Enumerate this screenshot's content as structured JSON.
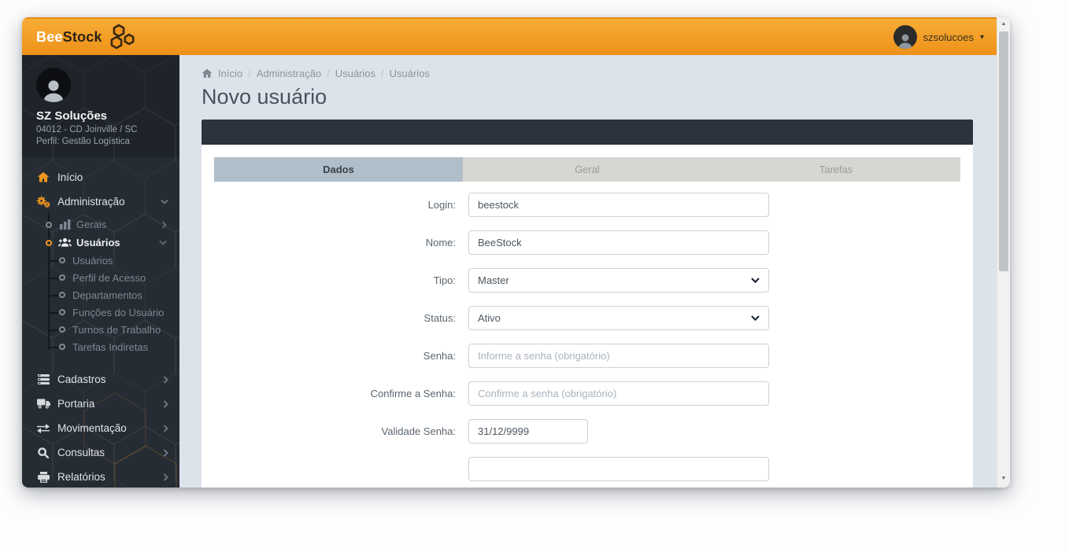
{
  "header": {
    "logo_bee": "Bee",
    "logo_stock": "Stock",
    "user_name": "szsolucoes"
  },
  "sidebar": {
    "profile": {
      "name": "SZ Soluções",
      "line1": "04012 - CD Joinville / SC",
      "line2": "Perfil: Gestão Logística"
    },
    "menu": {
      "inicio": "Início",
      "administracao": "Administração",
      "gerais": "Gerais",
      "usuarios_group": "Usuários",
      "sub": [
        "Usuários",
        "Perfil de Acesso",
        "Departamentos",
        "Funções do Usuário",
        "Turnos de Trabalho",
        "Tarefas Indiretas"
      ],
      "cadastros": "Cadastros",
      "portaria": "Portaria",
      "movimentacao": "Movimentação",
      "consultas": "Consultas",
      "relatorios": "Relatórios"
    }
  },
  "breadcrumb": {
    "items": [
      "Início",
      "Administração",
      "Usuários",
      "Usuários"
    ],
    "separator": "/"
  },
  "page": {
    "title": "Novo usuário"
  },
  "tabs": [
    {
      "label": "Dados"
    },
    {
      "label": "Geral"
    },
    {
      "label": "Tarefas"
    }
  ],
  "form": {
    "fields": [
      {
        "label": "Login:",
        "value": "beestock"
      },
      {
        "label": "Nome:",
        "value": "BeeStock"
      },
      {
        "label": "Tipo:",
        "value": "Master"
      },
      {
        "label": "Status:",
        "value": "Ativo"
      },
      {
        "label": "Senha:",
        "placeholder": "Informe a senha (obrigatório)"
      },
      {
        "label": "Confirme a Senha:",
        "placeholder": "Confirme a senha (obrigatório)"
      },
      {
        "label": "Validade Senha:",
        "value": "31/12/9999"
      }
    ]
  },
  "glyphs": {
    "caret_down": "▾",
    "scroll_up": "▲",
    "scroll_down": "▼"
  },
  "colors": {
    "accent_orange": "#f0941e",
    "header_gradient_top": "#f8ad36",
    "header_gradient_bottom": "#ee9118",
    "sidebar_bg": "#262c34",
    "panel_bar": "#2b333d",
    "tab_active_bg": "#b0bec9",
    "tab_inactive_bg": "#d8d6d2",
    "content_bg": "#dde3ea"
  }
}
